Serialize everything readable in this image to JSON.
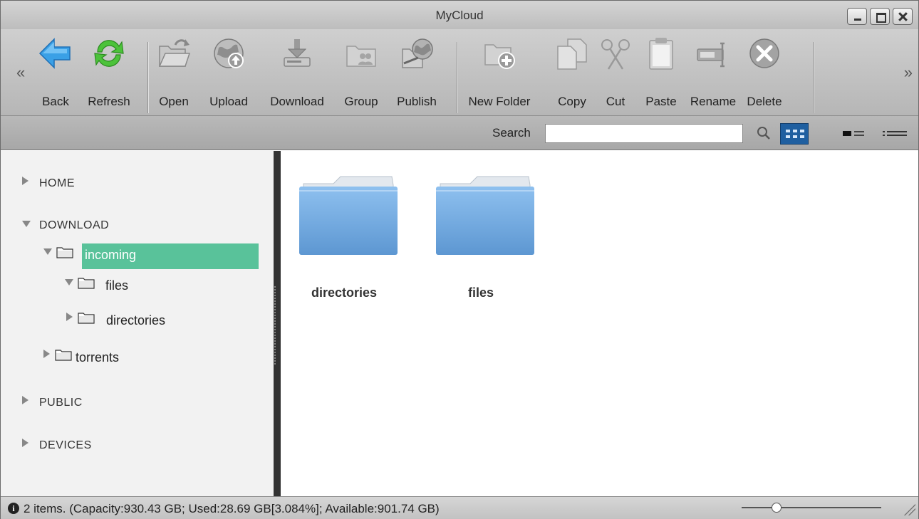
{
  "window": {
    "title": "MyCloud"
  },
  "toolbar": {
    "buttons": [
      {
        "id": "back",
        "label": "Back",
        "icon": "back-arrow-icon"
      },
      {
        "id": "refresh",
        "label": "Refresh",
        "icon": "refresh-icon"
      },
      {
        "id": "open",
        "label": "Open",
        "icon": "open-folder-icon"
      },
      {
        "id": "upload",
        "label": "Upload",
        "icon": "upload-globe-icon"
      },
      {
        "id": "download",
        "label": "Download",
        "icon": "download-icon"
      },
      {
        "id": "group",
        "label": "Group",
        "icon": "group-icon"
      },
      {
        "id": "publish",
        "label": "Publish",
        "icon": "publish-icon"
      },
      {
        "id": "new-folder",
        "label": "New Folder",
        "icon": "new-folder-icon"
      },
      {
        "id": "copy",
        "label": "Copy",
        "icon": "copy-icon"
      },
      {
        "id": "cut",
        "label": "Cut",
        "icon": "scissors-icon"
      },
      {
        "id": "paste",
        "label": "Paste",
        "icon": "clipboard-icon"
      },
      {
        "id": "rename",
        "label": "Rename",
        "icon": "rename-icon"
      },
      {
        "id": "delete",
        "label": "Delete",
        "icon": "delete-icon"
      }
    ]
  },
  "search": {
    "label": "Search",
    "value": ""
  },
  "sidebar": {
    "home": "HOME",
    "download": "DOWNLOAD",
    "incoming": "incoming",
    "files": "files",
    "directories": "directories",
    "torrents": "torrents",
    "public": "PUBLIC",
    "devices": "DEVICES"
  },
  "main": {
    "items": [
      {
        "name": "directories"
      },
      {
        "name": "files"
      }
    ]
  },
  "status": {
    "text": "2 items. (Capacity:930.43 GB; Used:28.69 GB[3.084%]; Available:901.74 GB)",
    "zoom_fraction": 0.25
  },
  "colors": {
    "selection": "#59c29a",
    "folder_blue": "#6fa6dc",
    "grid_view_active": "#1f5fa0"
  }
}
